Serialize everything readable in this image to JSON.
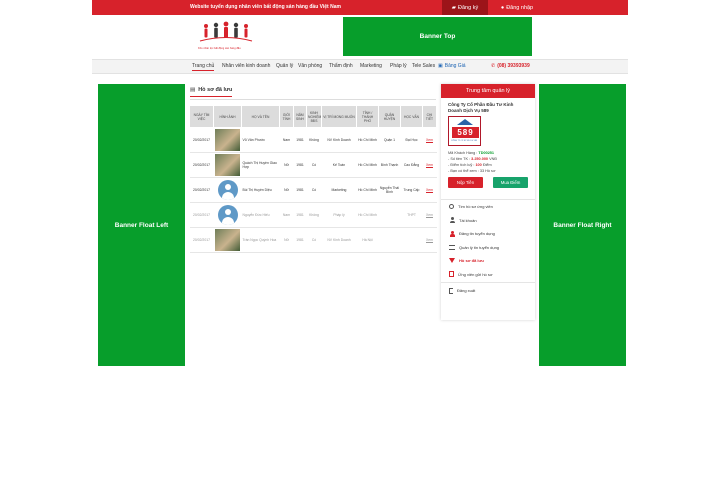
{
  "topbar": {
    "slogan": "Website tuyển dụng nhân viên bất động sản hàng đầu Việt Nam",
    "register_label": "Đăng ký",
    "login_label": "Đăng nhập"
  },
  "header": {
    "logo_tagline": "Kho nhân lực bất động sản hàng đầu",
    "banner_top": "Banner Top"
  },
  "nav": {
    "items": [
      "Trang chủ",
      "Nhân viên kinh doanh",
      "Quản lý",
      "Văn phòng",
      "Thẩm định",
      "Marketing",
      "Pháp lý",
      "Tele Sales"
    ],
    "price_label": "Bảng Giá",
    "phone": "(08) 39393939"
  },
  "banners": {
    "float_left": "Banner Float Left",
    "float_right": "Banner Float  Right"
  },
  "main": {
    "title": "Hồ sơ đã lưu",
    "columns": [
      "NGÀY TÌM VIỆC",
      "HÌNH ẢNH",
      "HỌ VÀ TÊN",
      "GIỚI TÍNH",
      "NĂM SINH",
      "KINH NGHIỆM BĐS",
      "VỊ TRÍ MONG MUỐN",
      "TỈNH / THÀNH PHỐ",
      "QUẬN HUYỆN",
      "HỌC VẤN",
      "CHI TIẾT"
    ],
    "rows": [
      {
        "date": "20/02/2017",
        "photo": "photo",
        "name": "Vũ Văn Phước",
        "gender": "Nam",
        "year": "1981",
        "exp": "Không",
        "position": "NV Kinh Doanh",
        "city": "Hồ Chí Minh",
        "district": "Quận 1",
        "edu": "Đại Học",
        "detail": "Xem"
      },
      {
        "date": "20/02/2017",
        "photo": "photo",
        "name": "Quách Thị Huyền Giao Hợp",
        "gender": "Nữ",
        "year": "1981",
        "exp": "Có",
        "position": "Kế Toán",
        "city": "Hồ Chí Minh",
        "district": "Bình Thạnh",
        "edu": "Cao Đẳng",
        "detail": "Xem"
      },
      {
        "date": "20/02/2017",
        "photo": "avatar",
        "name": "Bùi Thị Huyền Diệu",
        "gender": "Nữ",
        "year": "1981",
        "exp": "Có",
        "position": "Marketing",
        "city": "Hồ Chí Minh",
        "district": "Nguyễn Thái Bình",
        "edu": "Trung Cấp",
        "detail": "Xem"
      },
      {
        "date": "20/02/2017",
        "photo": "avatar",
        "name": "Nguyễn Đức Hiếu",
        "gender": "Nam",
        "year": "1981",
        "exp": "Không",
        "position": "Pháp lý",
        "city": "Hồ Chí Minh",
        "district": "",
        "edu": "THPT",
        "detail": "Xem"
      },
      {
        "date": "20/02/2017",
        "photo": "photo",
        "name": "Trần Ngọc Quỳnh Hoa",
        "gender": "Nữ",
        "year": "1981",
        "exp": "Có",
        "position": "NV Kinh Doanh",
        "city": "Hà Nội",
        "district": "",
        "edu": "",
        "detail": "Xem"
      }
    ]
  },
  "sidebar": {
    "title": "Trung tâm quản lý",
    "company": "Công Ty Cổ Phần Đầu Tư Kinh Doanh Dịch Vụ 589",
    "logo_number": "589",
    "logo_caption": "CÔNG TY CP ĐT KD DV 589",
    "customer_code_label": "Mã Khách Hàng :",
    "customer_code": "TD00251",
    "balance_label": "- Số tiền TK :",
    "balance": "3.250.000",
    "balance_unit": "VNĐ",
    "points_label": "- Điểm tích luỹ :",
    "points": "100",
    "points_unit": "Điểm",
    "views_label": "- Bạn có thể xem :",
    "views": "33 Hồ sơ",
    "pay_button": "Nộp Tiền",
    "buy_button": "Mua Điểm",
    "menu": [
      "Tìm hồ sơ ứng viên",
      "Tài khoản",
      "Đăng tin tuyển dụng",
      "Quản lý tin tuyển dụng",
      "Hồ sơ đã lưu",
      "Ứng viên gửi hồ sơ"
    ],
    "logout": "Đăng xuất"
  },
  "colors": {
    "brand_red": "#d7222b",
    "banner_green": "#079e2b"
  }
}
